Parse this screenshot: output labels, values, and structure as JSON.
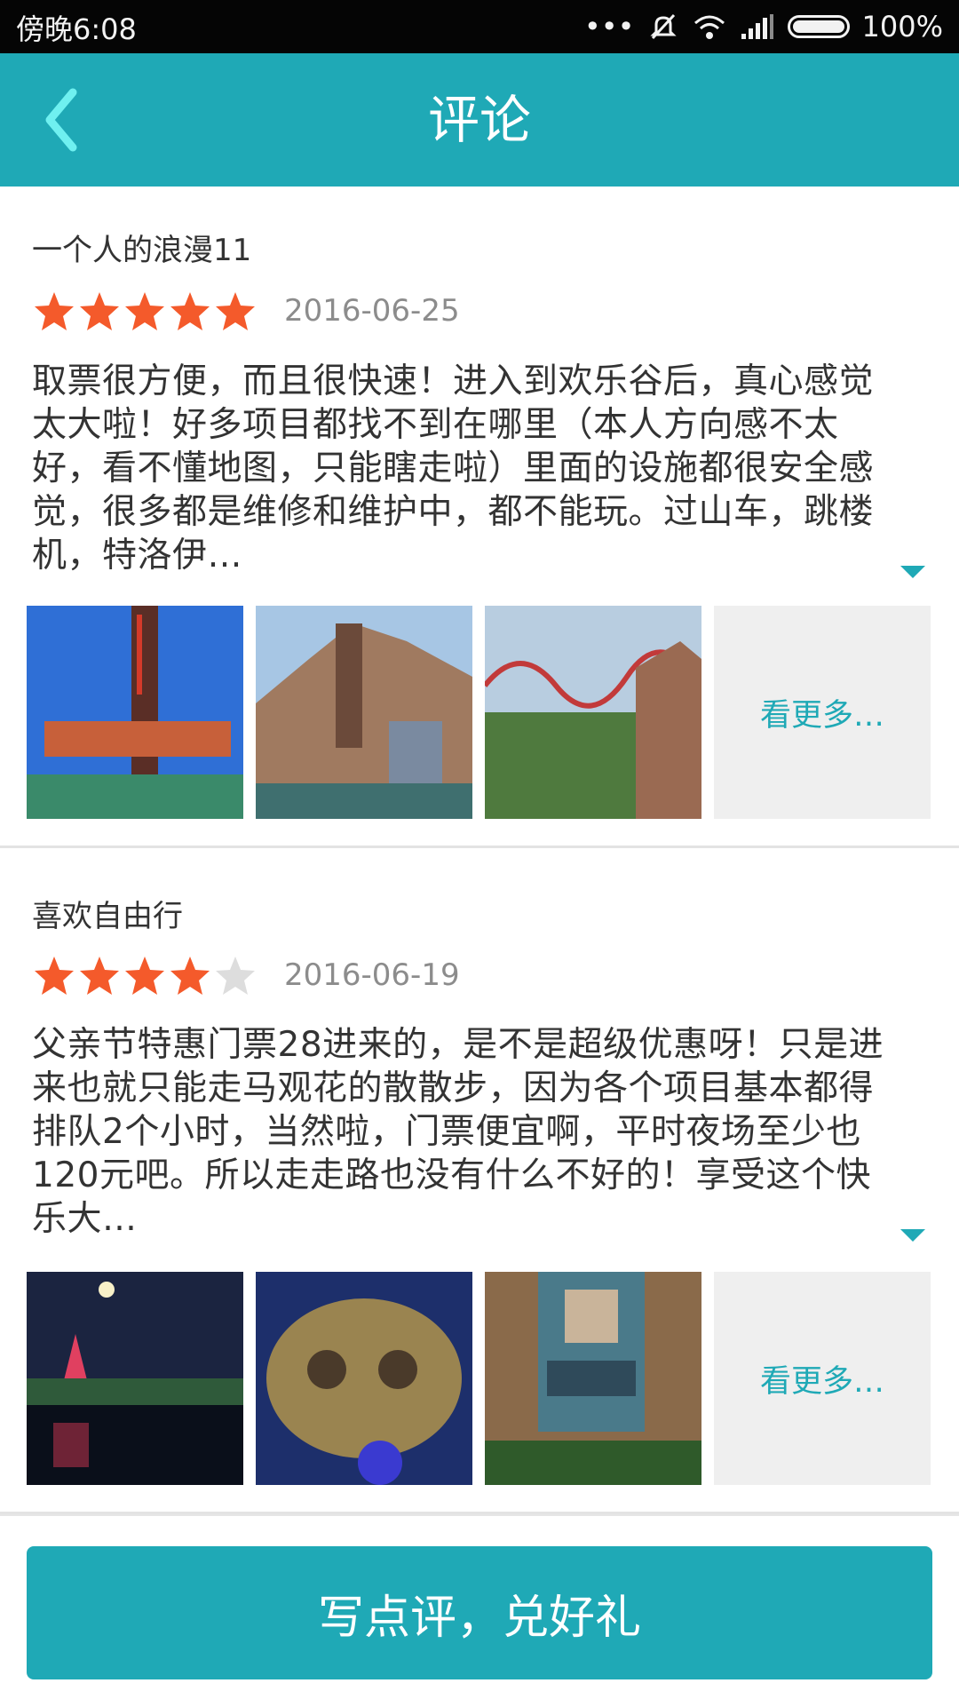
{
  "status_bar": {
    "time": "傍晚6:08",
    "battery": "100%"
  },
  "header": {
    "title": "评论"
  },
  "reviews": [
    {
      "user": "一个人的浪漫11",
      "rating": 5,
      "date": "2016-06-25",
      "text": "取票很方便，而且很快速！进入到欢乐谷后，真心感觉太大啦！好多项目都找不到在哪里（本人方向感不太好，看不懂地图，只能瞎走啦）里面的设施都很安全感觉，很多都是维修和维护中，都不能玩。过山车，跳楼机，特洛伊…",
      "more_label": "看更多…"
    },
    {
      "user": "喜欢自由行",
      "rating": 4,
      "date": "2016-06-19",
      "text": "父亲节特惠门票28进来的，是不是超级优惠呀！只是进来也就只能走马观花的散散步，因为各个项目基本都得排队2个小时，当然啦，门票便宜啊，平时夜场至少也120元吧。所以走走路也没有什么不好的！享受这个快乐大…",
      "more_label": "看更多…"
    }
  ],
  "footer": {
    "cta_label": "写点评，兑好礼"
  },
  "colors": {
    "accent": "#1fa9b6",
    "star_on": "#f45a2b",
    "star_off": "#dddddd"
  }
}
